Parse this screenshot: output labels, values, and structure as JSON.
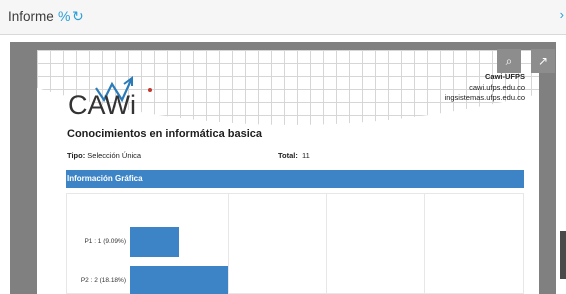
{
  "header": {
    "title": "Informe",
    "link_icon": "link-icon",
    "refresh_icon": "refresh-icon",
    "close_icon": "close-icon"
  },
  "viewer": {
    "toolbar": {
      "zoom_icon": "zoom-icon",
      "popout_icon": "popout-icon"
    }
  },
  "document": {
    "logo_text": "CAWi",
    "institution": {
      "name": "Cawi-UFPS",
      "site1": "cawi.ufps.edu.co",
      "site2": "ingsistemas.ufps.edu.co"
    },
    "title": "Conocimientos en informática basica",
    "tipo_label": "Tipo:",
    "tipo_value": "Selección Única",
    "total_label": "Total:",
    "total_value": "11",
    "section_header": "Información Gráfica"
  },
  "colors": {
    "accent": "#2a9fd8",
    "bar": "#3d84c6",
    "logo_red": "#c0392b"
  },
  "chart_data": {
    "type": "bar",
    "orientation": "horizontal",
    "categories": [
      "P1 : 1 (9.09%)",
      "P2 : 2 (18.18%)"
    ],
    "values": [
      1,
      2
    ],
    "xlim": [
      0,
      4
    ],
    "grid": true
  }
}
